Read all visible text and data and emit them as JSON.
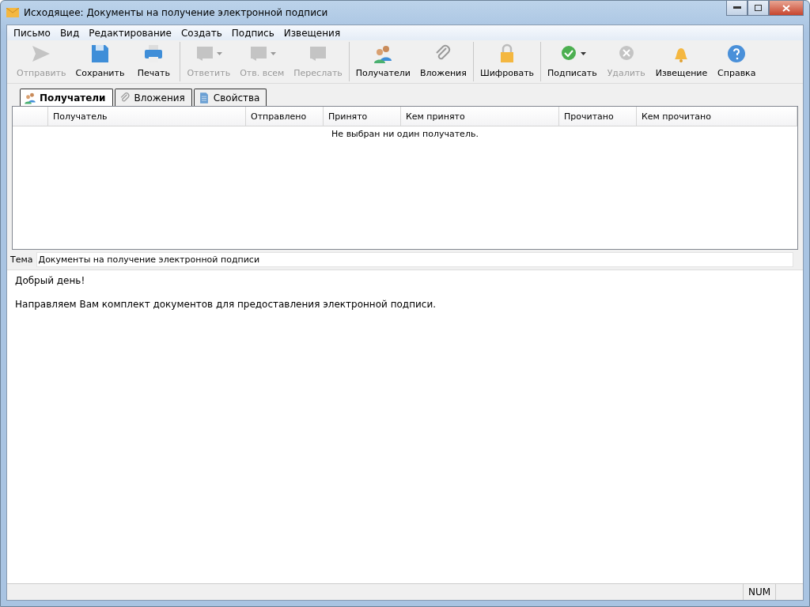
{
  "window": {
    "title": "Исходящее: Документы на получение электронной подписи"
  },
  "menu": [
    "Письмо",
    "Вид",
    "Редактирование",
    "Создать",
    "Подпись",
    "Извещения"
  ],
  "toolbar": [
    [
      {
        "label": "Отправить",
        "kind": "send",
        "disabled": true,
        "dropdown": false
      },
      {
        "label": "Сохранить",
        "kind": "save",
        "disabled": false,
        "dropdown": false
      },
      {
        "label": "Печать",
        "kind": "print",
        "disabled": false,
        "dropdown": false
      }
    ],
    [
      {
        "label": "Ответить",
        "kind": "reply",
        "disabled": true,
        "dropdown": true
      },
      {
        "label": "Отв. всем",
        "kind": "replyall",
        "disabled": true,
        "dropdown": true
      },
      {
        "label": "Переслать",
        "kind": "forward",
        "disabled": true,
        "dropdown": false
      }
    ],
    [
      {
        "label": "Получатели",
        "kind": "users",
        "disabled": false,
        "dropdown": false
      },
      {
        "label": "Вложения",
        "kind": "clip",
        "disabled": false,
        "dropdown": false
      }
    ],
    [
      {
        "label": "Шифровать",
        "kind": "lock",
        "disabled": false,
        "dropdown": false
      }
    ],
    [
      {
        "label": "Подписать",
        "kind": "sign",
        "disabled": false,
        "dropdown": true
      },
      {
        "label": "Удалить",
        "kind": "remove",
        "disabled": true,
        "dropdown": false
      },
      {
        "label": "Извещение",
        "kind": "bell",
        "disabled": false,
        "dropdown": false
      },
      {
        "label": "Справка",
        "kind": "help",
        "disabled": false,
        "dropdown": false
      }
    ]
  ],
  "tabs": [
    {
      "label": "Получатели",
      "kind": "users",
      "selected": true
    },
    {
      "label": "Вложения",
      "kind": "clip",
      "selected": false
    },
    {
      "label": "Свойства",
      "kind": "doc",
      "selected": false
    }
  ],
  "table": {
    "columns": [
      "Получатель",
      "Отправлено",
      "Принято",
      "Кем принято",
      "Прочитано",
      "Кем прочитано"
    ],
    "empty_message": "Не выбран ни один получатель."
  },
  "subject": {
    "label": "Тема",
    "value": "Документы на получение электронной подписи"
  },
  "body": [
    "Добрый день!",
    "Направляем Вам комплект документов для предоставления электронной подписи."
  ],
  "status_bar": {
    "indicator": "NUM"
  }
}
